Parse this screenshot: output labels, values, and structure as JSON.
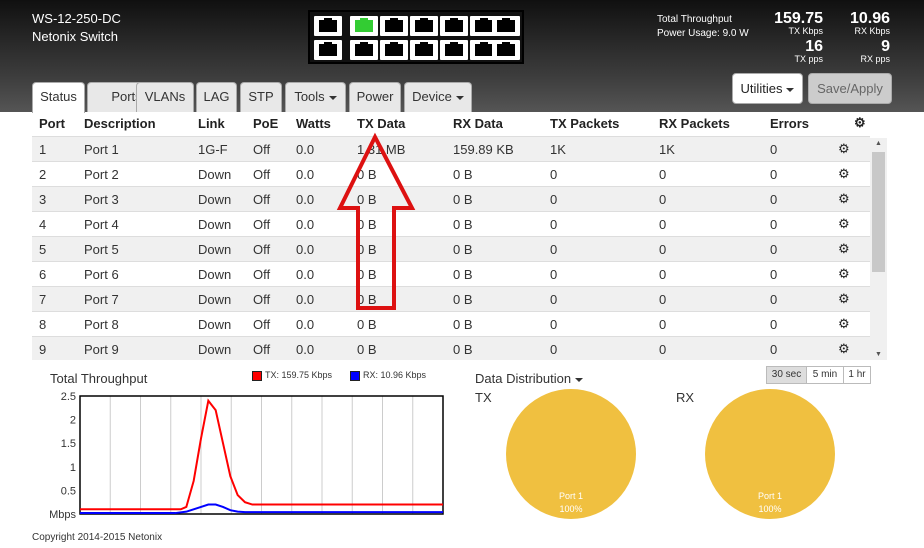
{
  "device": {
    "model": "WS-12-250-DC",
    "brand": "Netonix Switch"
  },
  "summary": {
    "throughput_label": "Total Throughput",
    "power_label": "Power Usage: 9.0 W",
    "tx_kbps": "159.75",
    "tx_kbps_label": "TX Kbps",
    "rx_kbps": "10.96",
    "rx_kbps_label": "RX Kbps",
    "tx_pps": "16",
    "tx_pps_label": "TX pps",
    "rx_pps": "9",
    "rx_pps_label": "RX pps"
  },
  "tabs": [
    {
      "label": "Status",
      "active": true
    },
    {
      "label": "Ports"
    },
    {
      "label": "VLANs"
    },
    {
      "label": "LAG"
    },
    {
      "label": "STP"
    },
    {
      "label": "Tools",
      "dropdown": true
    },
    {
      "label": "Power"
    },
    {
      "label": "Device",
      "dropdown": true
    }
  ],
  "buttons": {
    "utilities": "Utilities",
    "save": "Save/Apply"
  },
  "table": {
    "headers": [
      "Port",
      "Description",
      "Link",
      "PoE",
      "Watts",
      "TX Data",
      "RX Data",
      "TX Packets",
      "RX Packets",
      "Errors"
    ],
    "rows": [
      [
        "1",
        "Port 1",
        "1G-F",
        "Off",
        "0.0",
        "1.31 MB",
        "159.89 KB",
        "1K",
        "1K",
        "0"
      ],
      [
        "2",
        "Port 2",
        "Down",
        "Off",
        "0.0",
        "0 B",
        "0 B",
        "0",
        "0",
        "0"
      ],
      [
        "3",
        "Port 3",
        "Down",
        "Off",
        "0.0",
        "0 B",
        "0 B",
        "0",
        "0",
        "0"
      ],
      [
        "4",
        "Port 4",
        "Down",
        "Off",
        "0.0",
        "0 B",
        "0 B",
        "0",
        "0",
        "0"
      ],
      [
        "5",
        "Port 5",
        "Down",
        "Off",
        "0.0",
        "0 B",
        "0 B",
        "0",
        "0",
        "0"
      ],
      [
        "6",
        "Port 6",
        "Down",
        "Off",
        "0.0",
        "0 B",
        "0 B",
        "0",
        "0",
        "0"
      ],
      [
        "7",
        "Port 7",
        "Down",
        "Off",
        "0.0",
        "0 B",
        "0 B",
        "0",
        "0",
        "0"
      ],
      [
        "8",
        "Port 8",
        "Down",
        "Off",
        "0.0",
        "0 B",
        "0 B",
        "0",
        "0",
        "0"
      ],
      [
        "9",
        "Port 9",
        "Down",
        "Off",
        "0.0",
        "0 B",
        "0 B",
        "0",
        "0",
        "0"
      ]
    ]
  },
  "throughput_chart": {
    "title": "Total Throughput",
    "legend_tx": "TX: 159.75 Kbps",
    "legend_rx": "RX: 10.96 Kbps",
    "tx_color": "#ff0000",
    "rx_color": "#0000ff"
  },
  "distribution": {
    "title": "Data Distribution",
    "tx_label": "TX",
    "rx_label": "RX",
    "slice_label": "Port 1",
    "slice_pct": "100%",
    "color": "#f0c040"
  },
  "time_buttons": [
    "30 sec",
    "5 min",
    "1 hr"
  ],
  "footer": "Copyright 2014-2015 Netonix",
  "annotation_color": "#dd1111",
  "chart_data": [
    {
      "type": "line",
      "title": "Total Throughput",
      "ylabel": "Mbps",
      "ylim": [
        0,
        2.5
      ],
      "yticks": [
        "2.5",
        "2",
        "1.5",
        "1",
        "0.5",
        "Mbps"
      ],
      "series": [
        {
          "name": "TX: 159.75 Kbps",
          "color": "#ff0000",
          "x": [
            0,
            5,
            10,
            12,
            13,
            14,
            15,
            16,
            18,
            20,
            22,
            24,
            26,
            28,
            30,
            32,
            35,
            40,
            45,
            50,
            52,
            55,
            58,
            62,
            66,
            70,
            74,
            78,
            82,
            86,
            90,
            94,
            98,
            102,
            106,
            110,
            114,
            118,
            122,
            126,
            130,
            134,
            138,
            142,
            146,
            150,
            154,
            158,
            162,
            166,
            170,
            174,
            178,
            182,
            186,
            190,
            194,
            198
          ],
          "y": [
            0.1,
            0.1,
            0.1,
            0.1,
            0.1,
            0.1,
            0.1,
            0.1,
            0.1,
            0.1,
            0.1,
            0.1,
            0.1,
            0.1,
            0.1,
            0.1,
            0.1,
            0.1,
            0.1,
            0.1,
            0.1,
            0.1,
            0.15,
            0.7,
            1.6,
            2.4,
            2.2,
            1.5,
            0.8,
            0.4,
            0.25,
            0.2,
            0.2,
            0.2,
            0.2,
            0.2,
            0.2,
            0.2,
            0.2,
            0.2,
            0.2,
            0.2,
            0.2,
            0.2,
            0.2,
            0.2,
            0.2,
            0.2,
            0.2,
            0.2,
            0.2,
            0.2,
            0.2,
            0.2,
            0.2,
            0.2,
            0.2,
            0.2
          ]
        },
        {
          "name": "RX: 10.96 Kbps",
          "color": "#0000ff",
          "x": [
            0,
            20,
            40,
            52,
            58,
            62,
            66,
            70,
            74,
            78,
            82,
            86,
            90,
            110,
            130,
            150,
            170,
            198
          ],
          "y": [
            0.02,
            0.02,
            0.02,
            0.02,
            0.05,
            0.1,
            0.15,
            0.2,
            0.2,
            0.15,
            0.08,
            0.05,
            0.04,
            0.04,
            0.04,
            0.04,
            0.04,
            0.04
          ]
        }
      ]
    },
    {
      "type": "pie",
      "title": "TX",
      "categories": [
        "Port 1"
      ],
      "values": [
        100
      ]
    },
    {
      "type": "pie",
      "title": "RX",
      "categories": [
        "Port 1"
      ],
      "values": [
        100
      ]
    }
  ]
}
